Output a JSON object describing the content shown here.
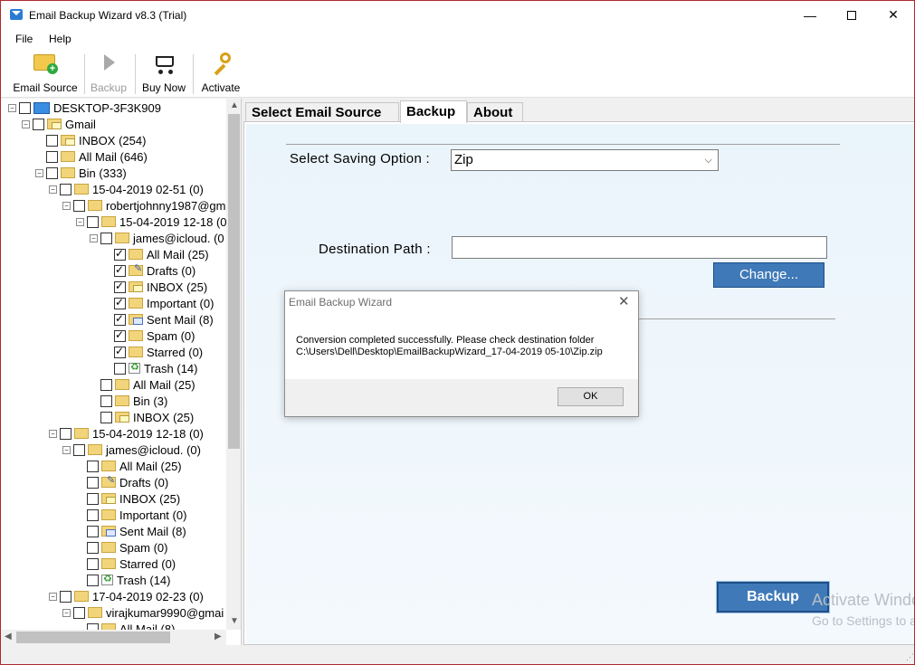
{
  "window": {
    "title": "Email Backup Wizard v8.3 (Trial)"
  },
  "menu": [
    "File",
    "Help"
  ],
  "toolbar": {
    "email_source": "Email Source",
    "backup": "Backup",
    "buy_now": "Buy Now",
    "activate": "Activate"
  },
  "tree": [
    {
      "label": "DESKTOP-3F3K909",
      "icon": "computer-icon",
      "exp": "−",
      "checked": false
    },
    {
      "label": "Gmail",
      "icon": "mail-folder-icon",
      "exp": "−",
      "checked": false
    },
    {
      "label": "INBOX (254)",
      "icon": "inbox-folder-icon",
      "exp": "",
      "checked": false
    },
    {
      "label": "All Mail (646)",
      "icon": "folder-icon",
      "exp": "",
      "checked": false
    },
    {
      "label": "Bin (333)",
      "icon": "folder-icon",
      "exp": "−",
      "checked": false
    },
    {
      "label": "15-04-2019 02-51 (0)",
      "icon": "folder-icon",
      "exp": "−",
      "checked": false
    },
    {
      "label": "robertjohnny1987@gm",
      "icon": "folder-icon",
      "exp": "−",
      "checked": false
    },
    {
      "label": "15-04-2019 12-18 (0)",
      "icon": "folder-icon",
      "exp": "−",
      "checked": false
    },
    {
      "label": "james@icloud. (0",
      "icon": "folder-icon",
      "exp": "−",
      "checked": false
    },
    {
      "label": "All Mail (25)",
      "icon": "folder-icon",
      "exp": "",
      "checked": true
    },
    {
      "label": "Drafts (0)",
      "icon": "drafts-folder-icon",
      "exp": "",
      "checked": true
    },
    {
      "label": "INBOX (25)",
      "icon": "inbox-folder-icon",
      "exp": "",
      "checked": true
    },
    {
      "label": "Important (0)",
      "icon": "folder-icon",
      "exp": "",
      "checked": true
    },
    {
      "label": "Sent Mail (8)",
      "icon": "sent-folder-icon",
      "exp": "",
      "checked": true
    },
    {
      "label": "Spam (0)",
      "icon": "folder-icon",
      "exp": "",
      "checked": true
    },
    {
      "label": "Starred (0)",
      "icon": "folder-icon",
      "exp": "",
      "checked": true
    },
    {
      "label": "Trash (14)",
      "icon": "trash-icon",
      "exp": "",
      "checked": false
    },
    {
      "label": "All Mail (25)",
      "icon": "folder-icon",
      "exp": "",
      "checked": false
    },
    {
      "label": "Bin (3)",
      "icon": "folder-icon",
      "exp": "",
      "checked": false
    },
    {
      "label": "INBOX (25)",
      "icon": "inbox-folder-icon",
      "exp": "",
      "checked": false
    },
    {
      "label": "15-04-2019 12-18 (0)",
      "icon": "folder-icon",
      "exp": "−",
      "checked": false
    },
    {
      "label": "james@icloud. (0)",
      "icon": "folder-icon",
      "exp": "−",
      "checked": false
    },
    {
      "label": "All Mail (25)",
      "icon": "folder-icon",
      "exp": "",
      "checked": false
    },
    {
      "label": "Drafts (0)",
      "icon": "drafts-folder-icon",
      "exp": "",
      "checked": false
    },
    {
      "label": "INBOX (25)",
      "icon": "inbox-folder-icon",
      "exp": "",
      "checked": false
    },
    {
      "label": "Important (0)",
      "icon": "folder-icon",
      "exp": "",
      "checked": false
    },
    {
      "label": "Sent Mail (8)",
      "icon": "sent-folder-icon",
      "exp": "",
      "checked": false
    },
    {
      "label": "Spam (0)",
      "icon": "folder-icon",
      "exp": "",
      "checked": false
    },
    {
      "label": "Starred (0)",
      "icon": "folder-icon",
      "exp": "",
      "checked": false
    },
    {
      "label": "Trash (14)",
      "icon": "trash-icon",
      "exp": "",
      "checked": false
    },
    {
      "label": "17-04-2019 02-23 (0)",
      "icon": "folder-icon",
      "exp": "−",
      "checked": false
    },
    {
      "label": "virajkumar9990@gmai",
      "icon": "folder-icon",
      "exp": "−",
      "checked": false
    },
    {
      "label": "All Mail (8)",
      "icon": "folder-icon",
      "exp": "",
      "checked": false
    }
  ],
  "tabs": [
    "Select Email Source",
    "Backup",
    "About"
  ],
  "backup": {
    "saving_option_label": "Select Saving Option :",
    "saving_option_value": "Zip",
    "destination_label": "Destination Path :",
    "destination_value": "",
    "change_button": "Change...",
    "backup_button": "Backup"
  },
  "watermark": {
    "line1": "Activate Windows",
    "line2": "Go to Settings to activate Windows."
  },
  "dialog": {
    "title": "Email Backup Wizard",
    "message_line1": "Conversion completed successfully. Please check destination folder",
    "message_line2": "C:\\Users\\Dell\\Desktop\\EmailBackupWizard_17-04-2019 05-10\\Zip.zip",
    "ok_button": "OK"
  }
}
